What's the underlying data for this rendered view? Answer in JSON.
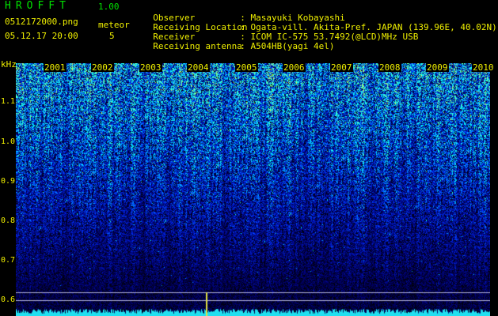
{
  "header": {
    "app_name": "HROFFT",
    "version": "1.00",
    "filename": "0512172000.png",
    "mode": "meteor",
    "datetime": "05.12.17 20:00",
    "meteor_count": "5"
  },
  "info": [
    {
      "label": "Observer",
      "value": ": Masayuki Kobayashi"
    },
    {
      "label": "Receiving Location",
      "value": ": Ogata-vill. Akita-Pref. JAPAN (139.96E, 40.02N)"
    },
    {
      "label": "Receiver",
      "value": ": ICOM IC-575 53.7492(@LCD)MHz USB"
    },
    {
      "label": "Receiving antenna",
      "value": ": A504HB(yagi 4el)"
    }
  ],
  "axis": {
    "unit": "kHz",
    "freq_labels": [
      "1.1",
      "1.0",
      "0.9",
      "0.8",
      "0.7",
      "0.6"
    ],
    "minute_labels": [
      "2001",
      "2002",
      "2003",
      "2004",
      "2005",
      "2006",
      "2007",
      "2008",
      "2009",
      "2010"
    ]
  },
  "colors": {
    "background": "#000000",
    "header_green": "#00e000",
    "label_yellow": "#f0f000"
  }
}
